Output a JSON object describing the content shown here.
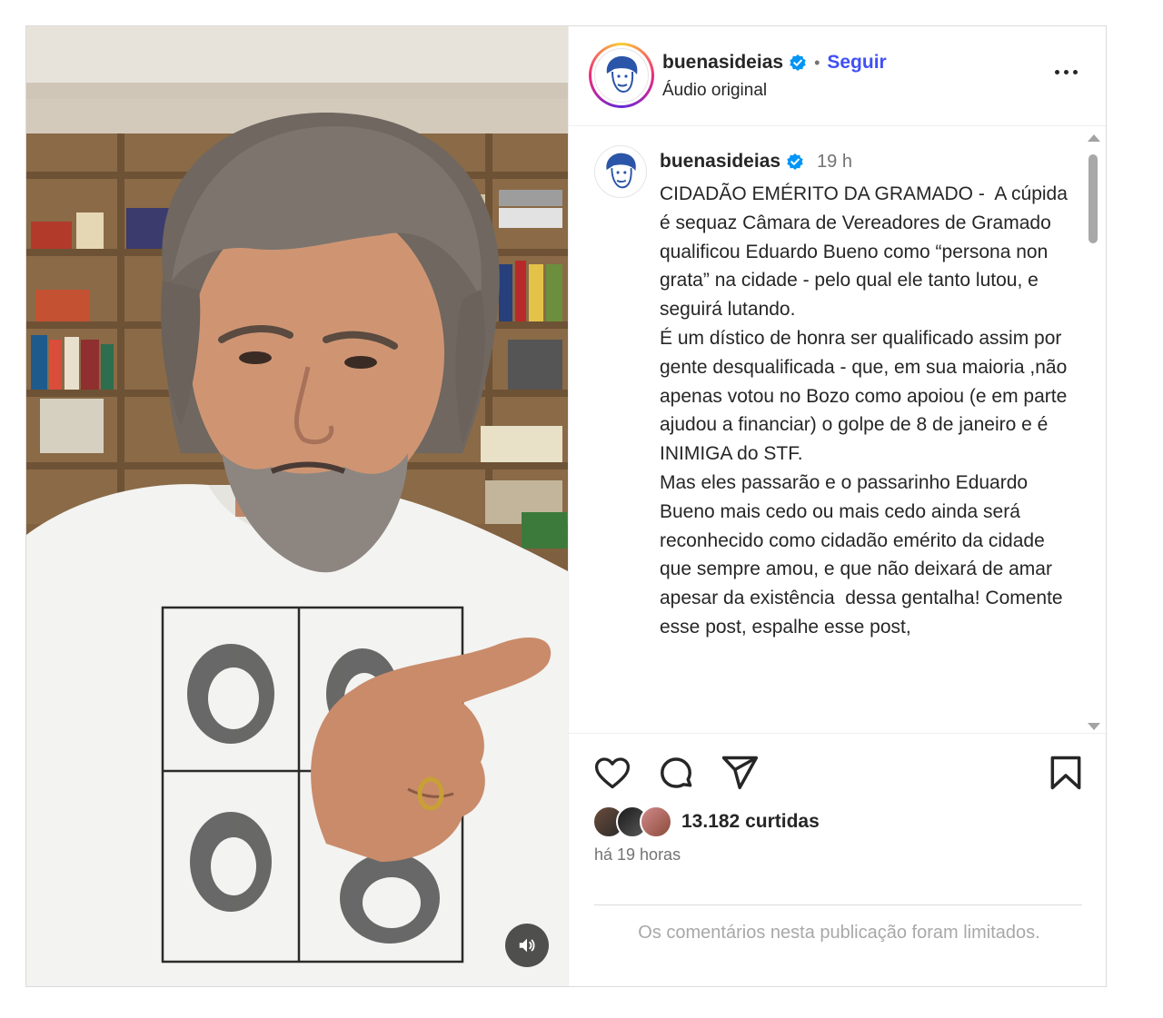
{
  "post": {
    "username": "buenasideias",
    "follow_label": "Seguir",
    "separator": "•",
    "audio_label": "Áudio original",
    "caption": {
      "username": "buenasideias",
      "time": "19 h",
      "text": "CIDADÃO EMÉRITO DA GRAMADO -  A cúpida é sequaz Câmara de Vereadores de Gramado qualificou Eduardo Bueno como “persona non grata” na cidade - pelo qual ele tanto lutou, e seguirá lutando.\nÉ um dístico de honra ser qualificado assim por gente desqualificada - que, em sua maioria ,não apenas votou no Bozo como apoiou (e em parte ajudou a financiar) o golpe de 8 de janeiro e é INIMIGA do STF.\nMas eles passarão e o passarinho Eduardo Bueno mais cedo ou mais cedo ainda será reconhecido como cidadão emérito da cidade que sempre amou, e que não deixará de amar apesar da existência  dessa gentalha! Comente esse post, espalhe esse post,"
    },
    "likes": "13.182 curtidas",
    "ago": "há 19 horas",
    "comments_limited": "Os comentários nesta publicação foram limitados.",
    "colors": {
      "follow": "#4150f7",
      "verified": "#0095f6",
      "secondary_text": "#737373",
      "muted_text": "#a8a8a8"
    },
    "icons": [
      "more-options-icon",
      "verified-badge-icon",
      "heart-icon",
      "comment-icon",
      "share-icon",
      "bookmark-icon",
      "volume-icon"
    ]
  }
}
